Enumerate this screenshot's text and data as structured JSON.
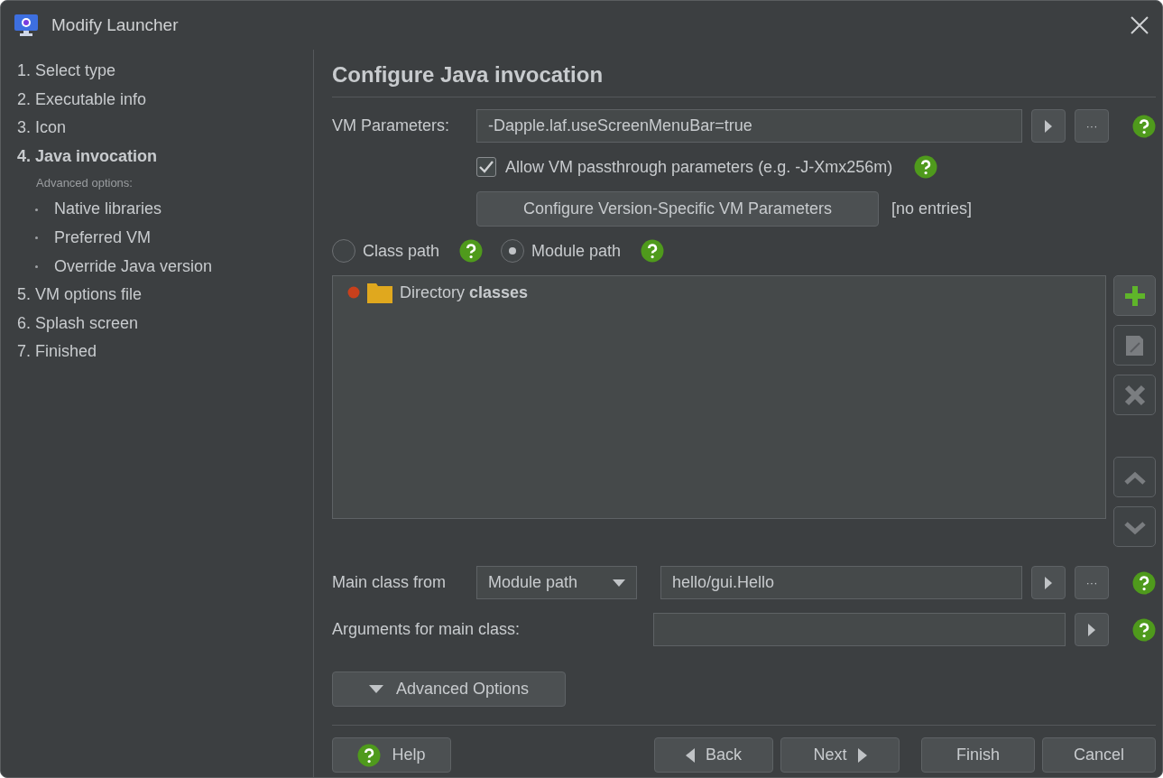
{
  "window": {
    "title": "Modify Launcher"
  },
  "sidebar": {
    "items": [
      {
        "label": "1. Select type",
        "selected": false
      },
      {
        "label": "2. Executable info",
        "selected": false
      },
      {
        "label": "3. Icon",
        "selected": false
      },
      {
        "label": "4. Java invocation",
        "selected": true,
        "sub_heading": "Advanced options:",
        "children": [
          {
            "label": "Native libraries",
            "selected": false
          },
          {
            "label": "Preferred VM",
            "selected": false
          },
          {
            "label": "Override Java version",
            "selected": false
          }
        ]
      },
      {
        "label": "5. VM options file",
        "selected": false
      },
      {
        "label": "6. Splash screen",
        "selected": false
      },
      {
        "label": "7. Finished",
        "selected": false
      }
    ]
  },
  "heading": "Configure Java invocation",
  "vm_parameters": {
    "label": "VM Parameters:",
    "value": "-Dapple.laf.useScreenMenuBar=true",
    "more_button": "···"
  },
  "passthrough": {
    "label": "Allow VM passthrough parameters (e.g. -J-Xmx256m)",
    "checked": true
  },
  "version_specific": {
    "button": "Configure Version-Specific VM Parameters",
    "status": "[no entries]"
  },
  "path_mode": [
    {
      "label": "Class path",
      "selected": false
    },
    {
      "label": "Module path",
      "selected": true
    }
  ],
  "path_entries": [
    {
      "text": "Directory **classes**"
    }
  ],
  "list_buttons": [
    {
      "kind": "add",
      "disabled": false
    },
    {
      "kind": "edit",
      "disabled": true
    },
    {
      "kind": "delete",
      "disabled": true
    },
    {
      "kind": "up",
      "disabled": true
    },
    {
      "kind": "down",
      "disabled": true
    }
  ],
  "main_class": {
    "label": "Main class from",
    "source": "Module path",
    "value": "hello/gui.Hello",
    "more_button": "···"
  },
  "arguments": {
    "label": "Arguments for main class:"
  },
  "advanced_button": "Advanced Options",
  "footer": {
    "help": "Help",
    "back": "Back",
    "next": "Next",
    "finish": "Finish",
    "cancel": "Cancel"
  }
}
